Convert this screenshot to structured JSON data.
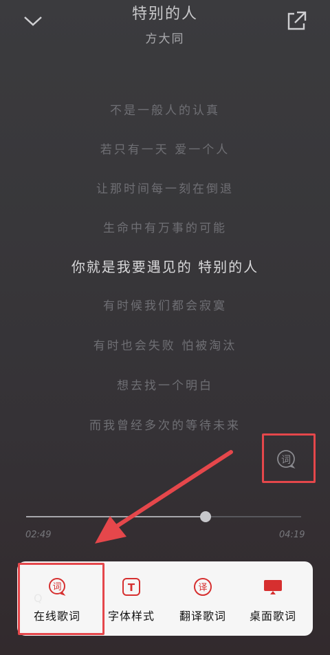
{
  "header": {
    "title": "特别的人",
    "artist": "方大同"
  },
  "lyrics": [
    "不是一般人的认真",
    "若只有一天 爱一个人",
    "让那时间每一刻在倒退",
    "生命中有万事的可能",
    "你就是我要遇见的 特别的人",
    "有时候我们都会寂寞",
    "有时也会失败 怕被淘汰",
    "想去找一个明白",
    "而我曾经多次的等待未来"
  ],
  "current_line_index": 4,
  "player": {
    "elapsed": "02:49",
    "total": "04:19",
    "progress": 0.6525
  },
  "lyric_icon": {
    "glyph": "词"
  },
  "sheet": {
    "items": [
      {
        "label": "在线歌词",
        "icon": "online-lyrics-icon",
        "glyph": "词"
      },
      {
        "label": "字体样式",
        "icon": "font-style-icon",
        "glyph": "T"
      },
      {
        "label": "翻译歌词",
        "icon": "translate-lyrics-icon",
        "glyph": "译"
      },
      {
        "label": "桌面歌词",
        "icon": "desktop-lyrics-icon",
        "glyph": ""
      }
    ]
  },
  "colors": {
    "accent": "#d62f2f",
    "highlight": "#e5474b"
  }
}
